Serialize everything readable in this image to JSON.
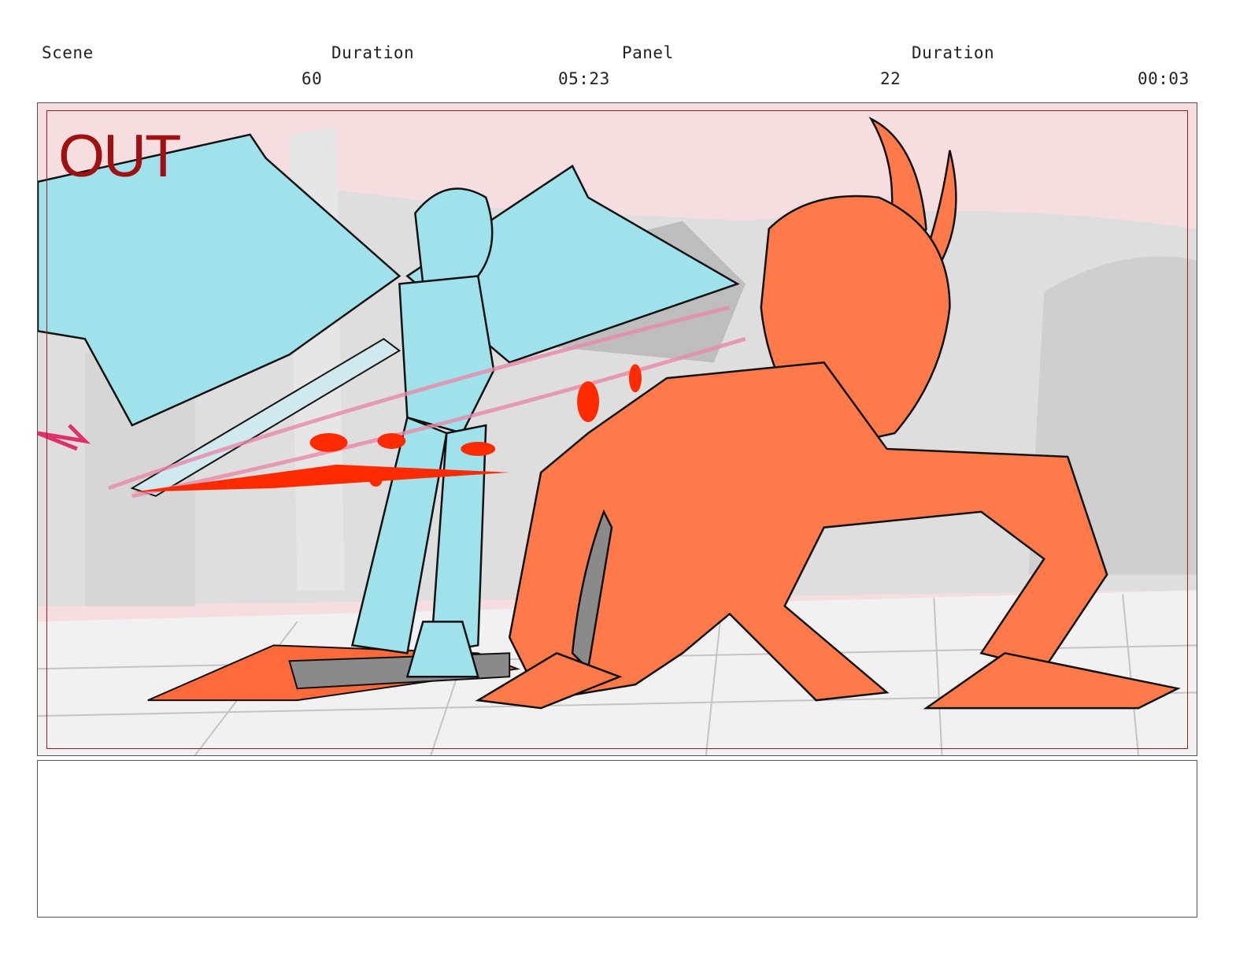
{
  "header": {
    "scene_label": "Scene",
    "scene_duration_label": "Duration",
    "panel_label": "Panel",
    "panel_duration_label": "Duration",
    "scene_number": "60",
    "scene_duration": "05:23",
    "panel_number": "22",
    "panel_duration": "00:03"
  },
  "panel": {
    "overlay_text": "OUT",
    "overlay_color": "#a01010",
    "character_left_color": "#9fe2ec",
    "character_right_color": "#ff7a4a",
    "blood_color": "#ff2a00",
    "sky_color": "#f5dde0"
  },
  "notes": {
    "text": ""
  }
}
